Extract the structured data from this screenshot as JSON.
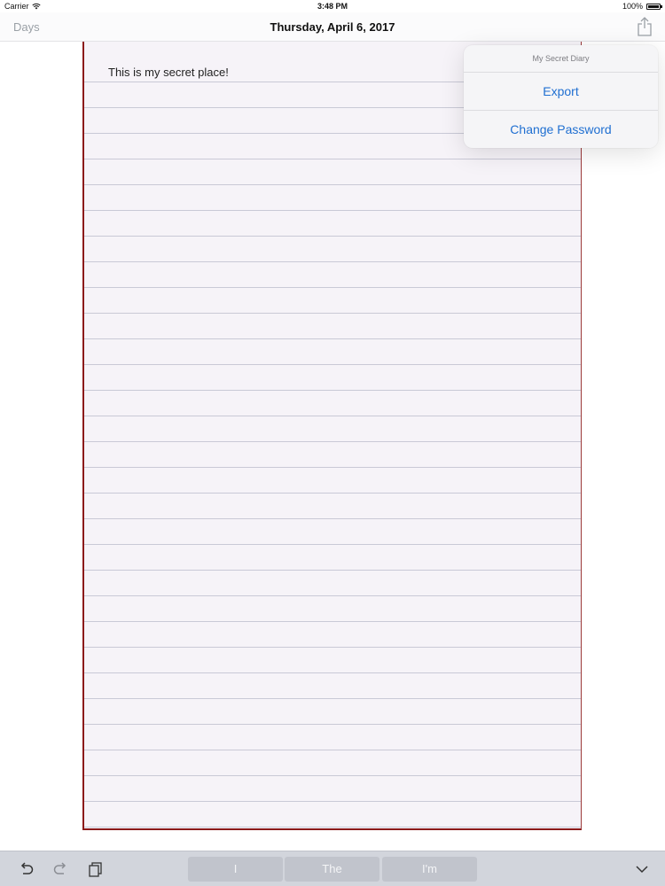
{
  "status_bar": {
    "carrier": "Carrier",
    "time": "3:48 PM",
    "battery_percent": "100%",
    "battery_level": 1.0
  },
  "nav": {
    "back_label": "Days",
    "title": "Thursday, April 6, 2017",
    "share_icon": "share-icon"
  },
  "diary": {
    "text": "This is my secret place!"
  },
  "popover": {
    "title": "My Secret Diary",
    "items": [
      {
        "label": "Export"
      },
      {
        "label": "Change Password"
      }
    ]
  },
  "keyboard_bar": {
    "undo_icon": "undo-icon",
    "redo_icon": "redo-icon",
    "paste_icon": "paste-icon",
    "suggestions": [
      "I",
      "The",
      "I'm"
    ],
    "dismiss_icon": "chevron-down-icon"
  },
  "colors": {
    "accent": "#1f6fd1",
    "paper_border": "#8b1a1a",
    "keyboard_bar": "#d2d5dc"
  }
}
